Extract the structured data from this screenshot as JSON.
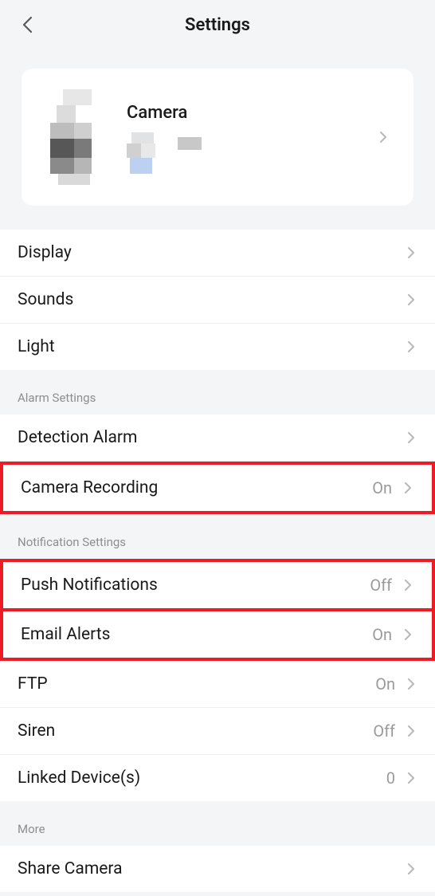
{
  "header": {
    "title": "Settings"
  },
  "device": {
    "name": "Camera"
  },
  "sections": {
    "general": {
      "display": "Display",
      "sounds": "Sounds",
      "light": "Light"
    },
    "alarm": {
      "header": "Alarm Settings",
      "detection": "Detection Alarm",
      "recording_label": "Camera Recording",
      "recording_value": "On"
    },
    "notification": {
      "header": "Notification Settings",
      "push_label": "Push Notifications",
      "push_value": "Off",
      "email_label": "Email Alerts",
      "email_value": "On",
      "ftp_label": "FTP",
      "ftp_value": "On",
      "siren_label": "Siren",
      "siren_value": "Off",
      "linked_label": "Linked Device(s)",
      "linked_value": "0"
    },
    "more": {
      "header": "More",
      "share": "Share Camera"
    }
  }
}
